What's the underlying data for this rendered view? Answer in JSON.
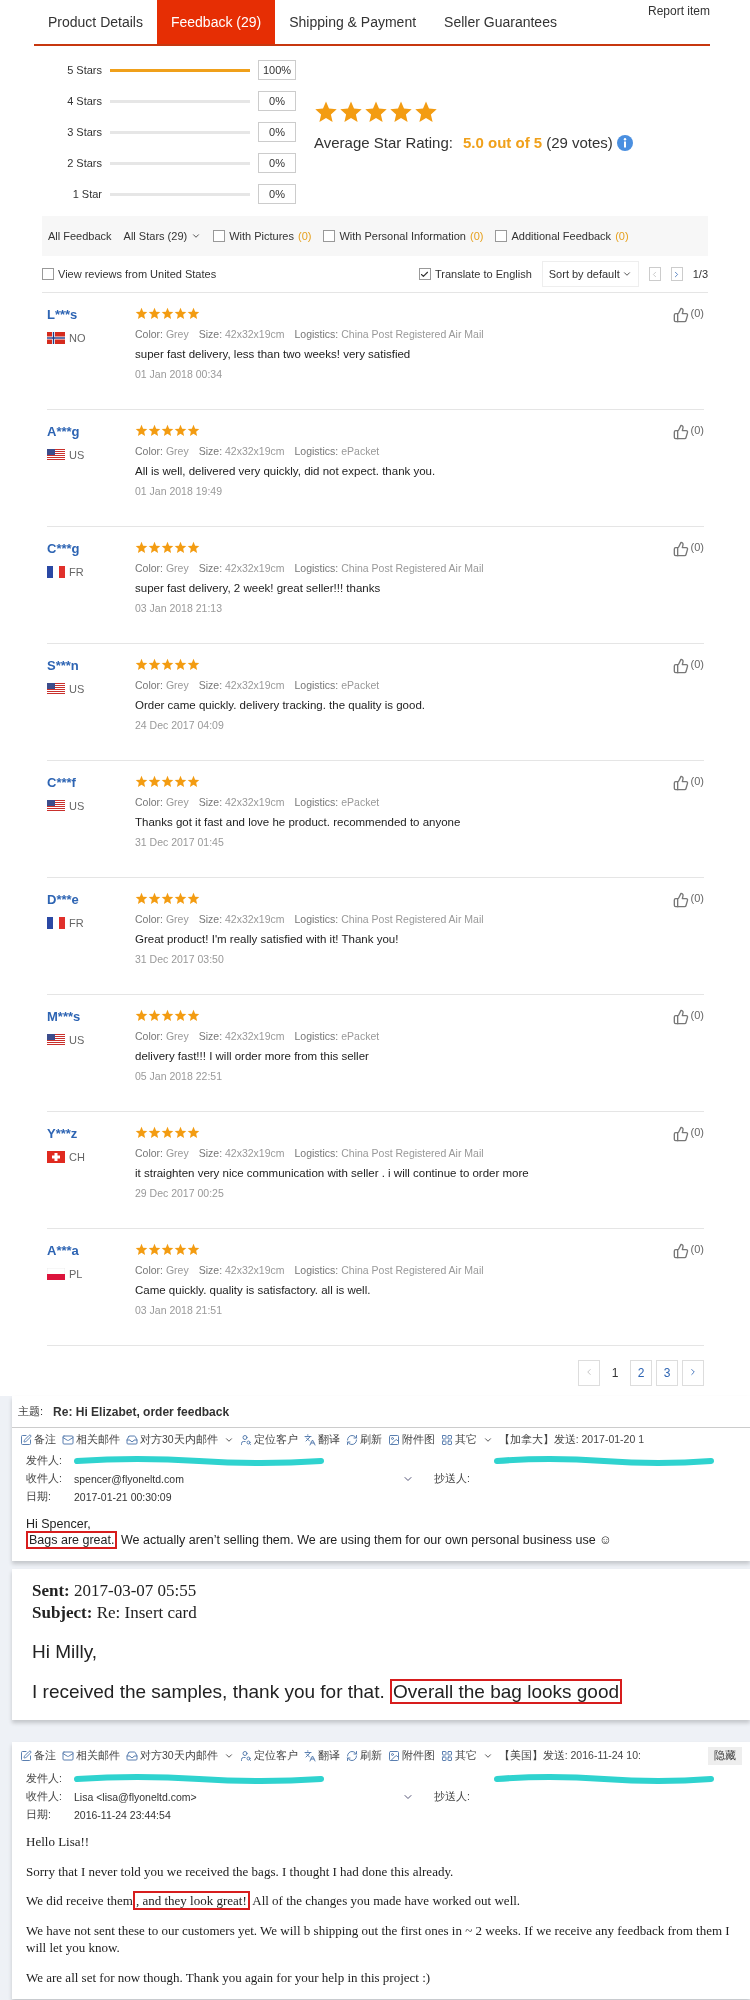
{
  "tabs": [
    {
      "label": "Product Details",
      "selected": false
    },
    {
      "label": "Feedback (29)",
      "selected": true
    },
    {
      "label": "Shipping & Payment",
      "selected": false
    },
    {
      "label": "Seller Guarantees",
      "selected": false
    }
  ],
  "report_link": "Report item",
  "rating_breakdown": [
    {
      "label": "5 Stars",
      "level": 1,
      "percent": "100%"
    },
    {
      "label": "4 Stars",
      "level": 0,
      "percent": "0%"
    },
    {
      "label": "3 Stars",
      "level": 0,
      "percent": "0%"
    },
    {
      "label": "2 Stars",
      "level": 0,
      "percent": "0%"
    },
    {
      "label": "1 Star",
      "level": 0,
      "percent": "0%"
    }
  ],
  "average": {
    "stars": 5,
    "label": "Average Star Rating:",
    "score": "5.0 out of 5",
    "votes": "(29 votes)"
  },
  "filter_bar": {
    "all_feedback": "All Feedback",
    "star_filter": "All Stars (29)",
    "checkboxes": [
      {
        "label": "With Pictures",
        "count": "(0)",
        "checked": false
      },
      {
        "label": "With Personal Information",
        "count": "(0)",
        "checked": false
      },
      {
        "label": "Additional Feedback",
        "count": "(0)",
        "checked": false
      }
    ]
  },
  "options": {
    "local_reviews": {
      "label": "View reviews from United States",
      "checked": false
    },
    "translate": {
      "label": "Translate to English",
      "checked": true
    },
    "sort": "Sort by default",
    "page": "1/3"
  },
  "reviews": [
    {
      "user": "L***s",
      "flag": {
        "kind": "no"
      },
      "country": "NO",
      "stars": 5,
      "attributes": [
        {
          "label": "Color:",
          "value": "Grey"
        },
        {
          "label": "Size:",
          "value": "42x32x19cm"
        },
        {
          "label": "Logistics:",
          "value": "China Post Registered Air Mail"
        }
      ],
      "text": "super fast delivery, less than two weeks! very satisfied",
      "date": "01 Jan 2018 00:34",
      "likes": "(0)"
    },
    {
      "user": "A***g",
      "flag": {
        "kind": "us"
      },
      "country": "US",
      "stars": 5,
      "attributes": [
        {
          "label": "Color:",
          "value": "Grey"
        },
        {
          "label": "Size:",
          "value": "42x32x19cm"
        },
        {
          "label": "Logistics:",
          "value": "ePacket"
        }
      ],
      "text": "All is well, delivered very quickly, did not expect. thank you.",
      "date": "01 Jan 2018 19:49",
      "likes": "(0)"
    },
    {
      "user": "C***g",
      "flag": {
        "kind": "fr"
      },
      "country": "FR",
      "stars": 5,
      "attributes": [
        {
          "label": "Color:",
          "value": "Grey"
        },
        {
          "label": "Size:",
          "value": "42x32x19cm"
        },
        {
          "label": "Logistics:",
          "value": "China Post Registered Air Mail"
        }
      ],
      "text": "super fast delivery, 2 week! great seller!!! thanks",
      "date": "03 Jan 2018 21:13",
      "likes": "(0)"
    },
    {
      "user": "S***n",
      "flag": {
        "kind": "us"
      },
      "country": "US",
      "stars": 5,
      "attributes": [
        {
          "label": "Color:",
          "value": "Grey"
        },
        {
          "label": "Size:",
          "value": "42x32x19cm"
        },
        {
          "label": "Logistics:",
          "value": "ePacket"
        }
      ],
      "text": "Order came quickly. delivery tracking. the quality is good.",
      "date": "24 Dec 2017 04:09",
      "likes": "(0)"
    },
    {
      "user": "C***f",
      "flag": {
        "kind": "us"
      },
      "country": "US",
      "stars": 5,
      "attributes": [
        {
          "label": "Color:",
          "value": "Grey"
        },
        {
          "label": "Size:",
          "value": "42x32x19cm"
        },
        {
          "label": "Logistics:",
          "value": "ePacket"
        }
      ],
      "text": "Thanks got it fast and love he product. recommended to anyone",
      "date": "31 Dec 2017 01:45",
      "likes": "(0)"
    },
    {
      "user": "D***e",
      "flag": {
        "kind": "fr"
      },
      "country": "FR",
      "stars": 5,
      "attributes": [
        {
          "label": "Color:",
          "value": "Grey"
        },
        {
          "label": "Size:",
          "value": "42x32x19cm"
        },
        {
          "label": "Logistics:",
          "value": "China Post Registered Air Mail"
        }
      ],
      "text": "Great product! I'm really satisfied with it! Thank you!",
      "date": "31 Dec 2017 03:50",
      "likes": "(0)"
    },
    {
      "user": "M***s",
      "flag": {
        "kind": "us"
      },
      "country": "US",
      "stars": 5,
      "attributes": [
        {
          "label": "Color:",
          "value": "Grey"
        },
        {
          "label": "Size:",
          "value": "42x32x19cm"
        },
        {
          "label": "Logistics:",
          "value": "ePacket"
        }
      ],
      "text": "delivery fast!!! I will order more from this seller",
      "date": "05 Jan 2018 22:51",
      "likes": "(0)"
    },
    {
      "user": "Y***z",
      "flag": {
        "kind": "ch"
      },
      "country": "CH",
      "stars": 5,
      "attributes": [
        {
          "label": "Color:",
          "value": "Grey"
        },
        {
          "label": "Size:",
          "value": "42x32x19cm"
        },
        {
          "label": "Logistics:",
          "value": "China Post Registered Air Mail"
        }
      ],
      "text": "it straighten very nice communication with seller . i will continue to order more",
      "date": "29 Dec 2017 00:25",
      "likes": "(0)"
    },
    {
      "user": "A***a",
      "flag": {
        "kind": "pl"
      },
      "country": "PL",
      "stars": 5,
      "attributes": [
        {
          "label": "Color:",
          "value": "Grey"
        },
        {
          "label": "Size:",
          "value": "42x32x19cm"
        },
        {
          "label": "Logistics:",
          "value": "China Post Registered Air Mail"
        }
      ],
      "text": "Came quickly. quality is satisfactory. all is well.",
      "date": "03 Jan 2018 21:51",
      "likes": "(0)"
    }
  ],
  "pagination": [
    {
      "label": "1",
      "selected": true
    },
    {
      "label": "2",
      "selected": false
    },
    {
      "label": "3",
      "selected": false
    }
  ],
  "email_1": {
    "subject_label": "主题:",
    "subject": "Re: Hi Elizabet, order feedback",
    "toolbar": [
      {
        "kind": "note",
        "label": "备注",
        "dropdown": false
      },
      {
        "kind": "mail",
        "label": "相关邮件",
        "dropdown": false
      },
      {
        "kind": "inbox",
        "label": "对方30天内邮件",
        "dropdown": true
      },
      {
        "kind": "locate",
        "label": "定位客户",
        "dropdown": false
      },
      {
        "kind": "translate",
        "label": "翻译",
        "dropdown": false
      },
      {
        "kind": "refresh",
        "label": "刷新",
        "dropdown": false
      },
      {
        "kind": "image",
        "label": "附件图",
        "dropdown": false
      },
      {
        "kind": "grid",
        "label": "其它",
        "dropdown": true
      }
    ],
    "sent": "【加拿大】发送: 2017-01-20 1",
    "from_label": "发件人:",
    "to_label": "收件人:",
    "to": "spencer@flyoneltd.com",
    "cc_label": "抄送人:",
    "date_label": "日期:",
    "date": "2017-01-21 00:30:09",
    "greeting": "Hi Spencer,",
    "highlight": "Bags are great.",
    "body": " We actually aren’t selling them. We are using them for our own personal business use ☺"
  },
  "email_2": {
    "sent_label": "Sent:",
    "sent": "2017-03-07 05:55",
    "subject_label": "Subject:",
    "subject": "Re: Insert card",
    "greeting": "Hi Milly,",
    "body": "I received the samples, thank you for that. ",
    "highlight": "Overall the bag looks good"
  },
  "email_3": {
    "toolbar": [
      {
        "kind": "note",
        "label": "备注",
        "dropdown": false
      },
      {
        "kind": "mail",
        "label": "相关邮件",
        "dropdown": false
      },
      {
        "kind": "inbox",
        "label": "对方30天内邮件",
        "dropdown": true
      },
      {
        "kind": "locate",
        "label": "定位客户",
        "dropdown": false
      },
      {
        "kind": "translate",
        "label": "翻译",
        "dropdown": false
      },
      {
        "kind": "refresh",
        "label": "刷新",
        "dropdown": false
      },
      {
        "kind": "image",
        "label": "附件图",
        "dropdown": false
      },
      {
        "kind": "grid",
        "label": "其它",
        "dropdown": true
      }
    ],
    "sent": "【美国】发送: 2016-11-24 10:",
    "hide": "隐藏",
    "from_label": "发件人:",
    "to_label": "收件人:",
    "to": "Lisa <lisa@flyoneltd.com>",
    "cc_label": "抄送人:",
    "date_label": "日期:",
    "date": "2016-11-24 23:44:54",
    "paragraphs": [
      {
        "text": "Hello Lisa!!"
      },
      {
        "text": "Sorry that I never told you we received the bags. I thought I had done this already."
      },
      {
        "text": "We did receive them",
        "highlight": ", and they look great!",
        "after": " All of the changes you made have worked out well."
      },
      {
        "text": "We have not sent these to our customers yet. We will b shipping out the first ones in ~ 2 weeks. If we receive any feedback from them I will let you know."
      },
      {
        "text": "We are all set for now though. Thank you again for your help in this project :)"
      }
    ]
  }
}
